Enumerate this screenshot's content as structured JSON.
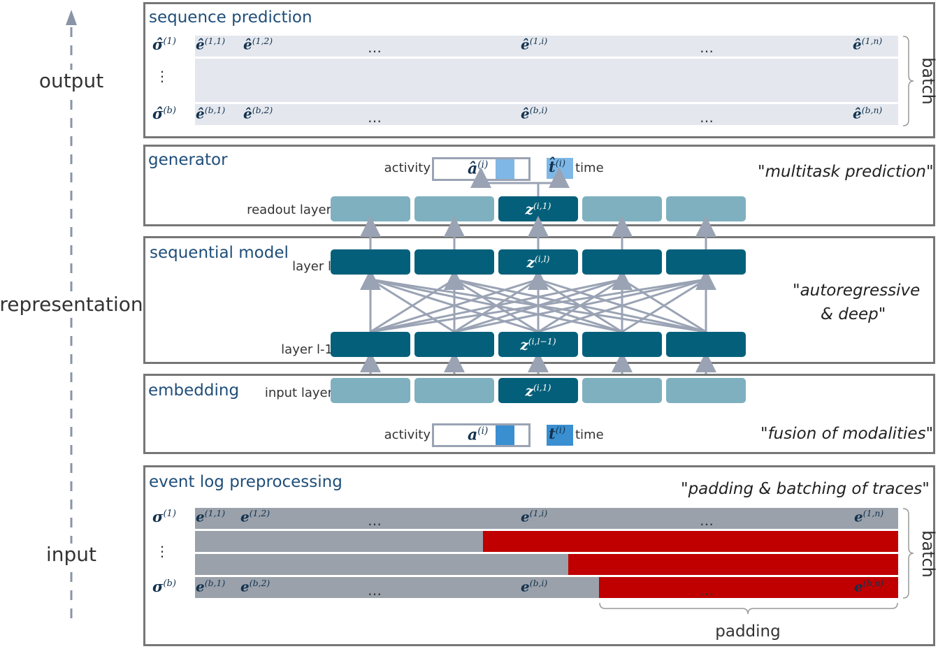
{
  "side_labels": {
    "output": "output",
    "representation": "representation",
    "input": "input"
  },
  "sequence_prediction": {
    "title": "sequence prediction",
    "batch": "batch",
    "row1": {
      "sigma": "σ̂",
      "sigma_sup": "(1)",
      "e1": "ê",
      "e1_sup": "(1,1)",
      "e2": "ê",
      "e2_sup": "(1,2)",
      "ei": "ê",
      "ei_sup": "(1,i)",
      "en": "ê",
      "en_sup": "(1,n)"
    },
    "vdots": "⋮",
    "rowb": {
      "sigma": "σ̂",
      "sigma_sup": "(b)",
      "e1": "ê",
      "e1_sup": "(b,1)",
      "e2": "ê",
      "e2_sup": "(b,2)",
      "ei": "ê",
      "ei_sup": "(b,i)",
      "en": "ê",
      "en_sup": "(b,n)"
    },
    "ellipsis": "…"
  },
  "generator": {
    "title": "generator",
    "quote": "\"multitask prediction\"",
    "activity_label": "activity",
    "activity_sym": "â",
    "activity_sup": "(i)",
    "time_sym": "t̂",
    "time_sup": "(i)",
    "time_label": "time",
    "readout_label": "readout layer",
    "center_sym": "z",
    "center_sup": "(i,1)"
  },
  "sequential_model": {
    "title": "sequential model",
    "quote_line1": "\"autoregressive",
    "quote_line2": "& deep\"",
    "layer_l_label": "layer l",
    "layer_l1_label": "layer l-1",
    "top_sym": "z",
    "top_sup": "(i,l)",
    "bottom_sym": "z",
    "bottom_sup": "(i,l−1)"
  },
  "embedding": {
    "title": "embedding",
    "quote": "\"fusion of modalities\"",
    "input_label": "input layer",
    "center_sym": "z",
    "center_sup": "(i,1)",
    "activity_label": "activity",
    "activity_sym": "a",
    "activity_sup": "(i)",
    "time_sym": "t",
    "time_sup": "(i)",
    "time_label": "time"
  },
  "preprocessing": {
    "title": "event log preprocessing",
    "quote": "\"padding & batching of traces\"",
    "batch": "batch",
    "padding": "padding",
    "row1": {
      "sigma": "σ",
      "sigma_sup": "(1)",
      "e1": "e",
      "e1_sup": "(1,1)",
      "e2": "e",
      "e2_sup": "(1,2)",
      "ei": "e",
      "ei_sup": "(1,i)",
      "en": "e",
      "en_sup": "(1,n)"
    },
    "vdots": "⋮",
    "rowb": {
      "sigma": "σ",
      "sigma_sup": "(b)",
      "e1": "e",
      "e1_sup": "(b,1)",
      "e2": "e",
      "e2_sup": "(b,2)",
      "ei": "e",
      "ei_sup": "(b,i)",
      "en": "e",
      "en_sup": "(b,n)"
    },
    "ellipsis": "…"
  },
  "colors": {
    "panel_border": "#767676",
    "title_blue": "#1f4e79",
    "light_box": "#7fb0bf",
    "dark_box": "#04607a",
    "strip_light": "#e4e8ee",
    "strip_grey": "#9aa1aa",
    "padding_red": "#c00000",
    "accent_blue": "#3a8fd0",
    "accent_blue_light": "#7fb8e6",
    "arrow_grey": "#9aa3b4"
  }
}
